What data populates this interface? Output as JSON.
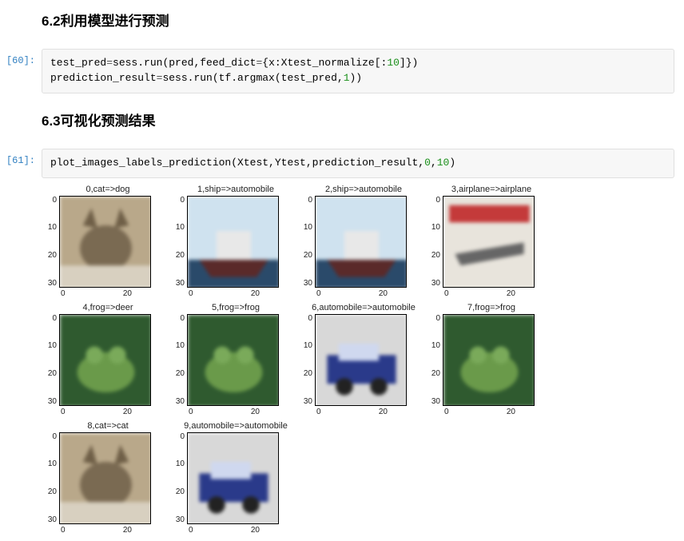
{
  "section1": {
    "heading": "6.2利用模型进行预测"
  },
  "section2": {
    "heading": "6.3可视化预测结果"
  },
  "cell60": {
    "prompt": "[60]:",
    "code_line1_a": "test_pred",
    "code_line1_b": "=",
    "code_line1_c": "sess.run(pred,feed_dict",
    "code_line1_d": "=",
    "code_line1_e": "{x:Xtest_normalize[:",
    "code_line1_f": "10",
    "code_line1_g": "]})",
    "code_line2_a": "prediction_result",
    "code_line2_b": "=",
    "code_line2_c": "sess.run(tf.argmax(test_pred,",
    "code_line2_d": "1",
    "code_line2_e": "))"
  },
  "cell61": {
    "prompt": "[61]:",
    "code_a": "plot_images_labels_prediction(Xtest,Ytest,prediction_result,",
    "code_b": "0",
    "code_c": ",",
    "code_d": "10",
    "code_e": ")"
  },
  "chart_data": {
    "type": "image-grid",
    "rows": 2,
    "cols": 5,
    "y_ticks": [
      "0",
      "10",
      "20",
      "30"
    ],
    "x_ticks": [
      "0",
      "20"
    ],
    "subplots": [
      {
        "title": "0,cat=>dog",
        "desc": "cat"
      },
      {
        "title": "1,ship=>automobile",
        "desc": "ship"
      },
      {
        "title": "2,ship=>automobile",
        "desc": "ship"
      },
      {
        "title": "3,airplane=>airplane",
        "desc": "airplane-poster"
      },
      {
        "title": "4,frog=>deer",
        "desc": "frog"
      },
      {
        "title": "5,frog=>frog",
        "desc": "frog"
      },
      {
        "title": "6,automobile=>automobile",
        "desc": "automobile"
      },
      {
        "title": "7,frog=>frog",
        "desc": "frog"
      },
      {
        "title": "8,cat=>cat",
        "desc": "cat"
      },
      {
        "title": "9,automobile=>automobile",
        "desc": "automobile"
      }
    ]
  }
}
